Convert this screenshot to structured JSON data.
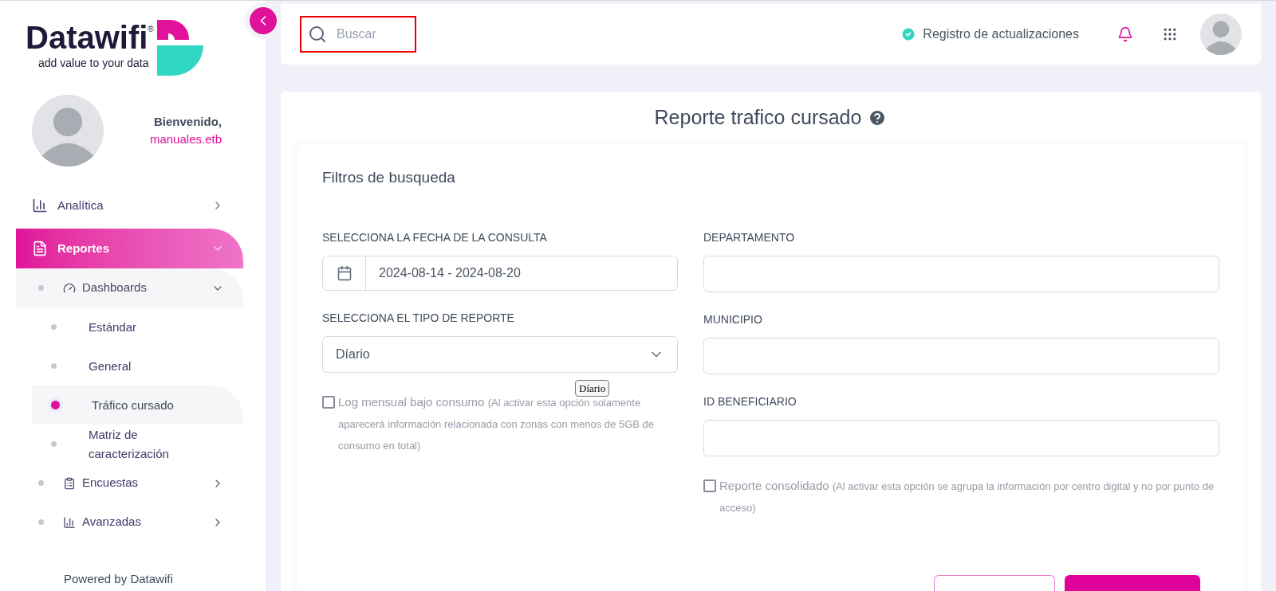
{
  "brand": {
    "name": "Datawifi",
    "registered": "®",
    "tagline": "add value to your data"
  },
  "user": {
    "greeting": "Bienvenido,",
    "username": "manuales.etb"
  },
  "menu": [
    {
      "label": "Analítica",
      "expanded": false,
      "selected": false
    },
    {
      "label": "Reportes",
      "expanded": true,
      "selected": true,
      "children": [
        {
          "label": "Dashboards",
          "expanded": true,
          "children": [
            {
              "label": "Estándar",
              "selected": false
            },
            {
              "label": "General",
              "selected": false
            },
            {
              "label": "Tráfico cursado",
              "selected": true
            },
            {
              "label": "Matriz de caracterización",
              "selected": false
            }
          ]
        },
        {
          "label": "Encuestas",
          "expanded": false
        },
        {
          "label": "Avanzadas",
          "expanded": false
        }
      ]
    }
  ],
  "footer": "Powered by Datawifi",
  "header": {
    "search": {
      "placeholder": "Buscar",
      "highlighted": true
    },
    "updates_link": "Registro de actualizaciones"
  },
  "page_title": "Reporte trafico cursado",
  "filters": {
    "title": "Filtros de busqueda",
    "left": [
      {
        "kind": "date",
        "label": "SELECCIONA LA FECHA DE LA CONSULTA",
        "value": "2024-08-14 - 2024-08-20"
      },
      {
        "kind": "select",
        "label": "SELECCIONA EL TIPO DE REPORTE",
        "value": "Díario",
        "tooltip": "Díario"
      },
      {
        "kind": "checkbox",
        "label": "Log mensual bajo consumo",
        "note": "(Al activar esta opción solamente aparecerá información relacionada con zonas con menos de 5GB de consumo en total)",
        "checked": false
      }
    ],
    "right": [
      {
        "kind": "text",
        "label": "DEPARTAMENTO"
      },
      {
        "kind": "text",
        "label": "MUNICIPIO"
      },
      {
        "kind": "text",
        "label": "ID BENEFICIARIO"
      },
      {
        "kind": "checkbox",
        "label": "Reporte consolidado",
        "note": "(Al activar esta opción se agrupa la información por centro digital y no por punto de acceso)",
        "checked": false
      }
    ]
  }
}
